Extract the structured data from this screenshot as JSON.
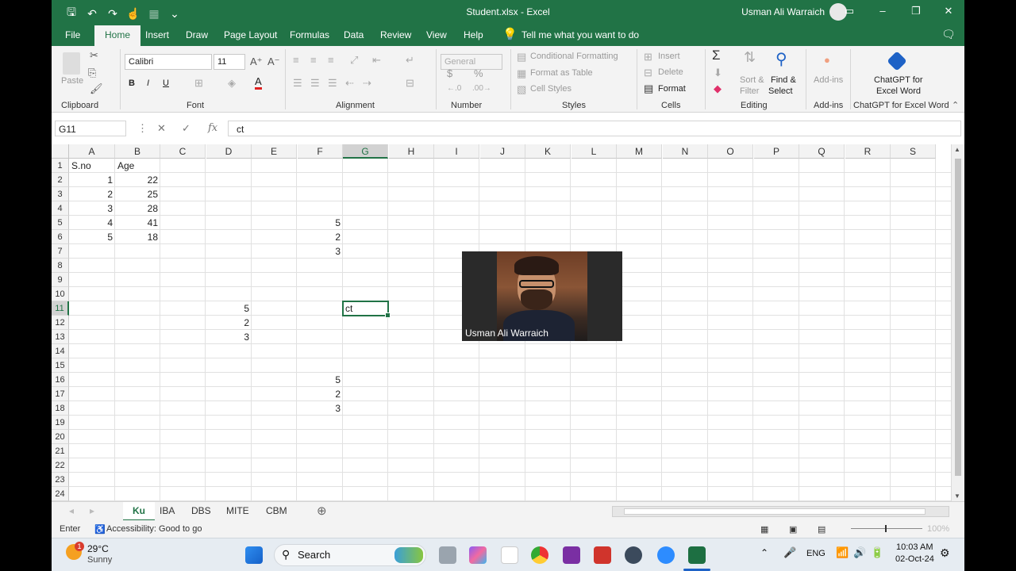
{
  "titlebar": {
    "doc_title": "Student.xlsx  -  Excel",
    "user_name": "Usman Ali Warraich",
    "icons": [
      "save-icon",
      "undo-icon",
      "redo-icon",
      "touch-mode-icon",
      "customize-icon"
    ]
  },
  "menu": {
    "tabs": [
      "File",
      "Home",
      "Insert",
      "Draw",
      "Page Layout",
      "Formulas",
      "Data",
      "Review",
      "View",
      "Help"
    ],
    "active": "Home",
    "tell_me": "Tell me what you want to do"
  },
  "ribbon": {
    "clipboard": {
      "label": "Clipboard",
      "paste": "Paste"
    },
    "font": {
      "label": "Font",
      "family": "Calibri",
      "size": "11",
      "bold": "B",
      "italic": "I",
      "underline": "U"
    },
    "alignment": {
      "label": "Alignment"
    },
    "number": {
      "label": "Number",
      "format": "General",
      "currency": "$",
      "percent": "%"
    },
    "styles": {
      "label": "Styles",
      "conditional": "Conditional Formatting",
      "format_table": "Format as Table",
      "cell_styles": "Cell Styles"
    },
    "cells": {
      "label": "Cells",
      "insert": "Insert",
      "delete": "Delete",
      "format": "Format"
    },
    "editing": {
      "label": "Editing",
      "sort_filter_1": "Sort &",
      "sort_filter_2": "Filter",
      "find_select_1": "Find &",
      "find_select_2": "Select"
    },
    "addins": {
      "label": "Add-ins",
      "btn": "Add-ins"
    },
    "chatgpt": {
      "label": "ChatGPT for Excel Word",
      "btn_1": "ChatGPT for",
      "btn_2": "Excel Word"
    }
  },
  "formula_bar": {
    "name_box": "G11",
    "fx": "fx",
    "content": "ct"
  },
  "grid": {
    "columns": [
      "A",
      "B",
      "C",
      "D",
      "E",
      "F",
      "G",
      "H",
      "I",
      "J",
      "K",
      "L",
      "M",
      "N",
      "O",
      "P",
      "Q",
      "R",
      "S"
    ],
    "selected_column": "G",
    "rows": [
      "1",
      "2",
      "3",
      "4",
      "5",
      "6",
      "7",
      "8",
      "9",
      "10",
      "11",
      "12",
      "13",
      "14",
      "15",
      "16",
      "17",
      "18",
      "19",
      "20",
      "21",
      "22",
      "23",
      "24"
    ],
    "selected_row": "11",
    "cells": {
      "A1": "S.no",
      "B1": "Age",
      "A2": "1",
      "B2": "22",
      "A3": "2",
      "B3": "25",
      "A4": "3",
      "B4": "28",
      "A5": "4",
      "B5": "41",
      "F5": "5",
      "A6": "5",
      "B6": "18",
      "F6": "2",
      "F7": "3",
      "D11": "5",
      "G11": "ct",
      "D12": "2",
      "D13": "3",
      "F16": "5",
      "F17": "2",
      "F18": "3"
    }
  },
  "video": {
    "participant": "Usman Ali Warraich"
  },
  "sheets": {
    "tabs": [
      "Ku",
      "IBA",
      "DBS",
      "MITE",
      "CBM"
    ],
    "active": "Ku"
  },
  "status": {
    "mode": "Enter",
    "accessibility": "Accessibility: Good to go",
    "zoom": "100%"
  },
  "taskbar": {
    "weather_temp": "29°C",
    "weather_desc": "Sunny",
    "weather_badge": "1",
    "search": "Search",
    "lang": "ENG",
    "time": "10:03 AM",
    "date": "02-Oct-24"
  }
}
